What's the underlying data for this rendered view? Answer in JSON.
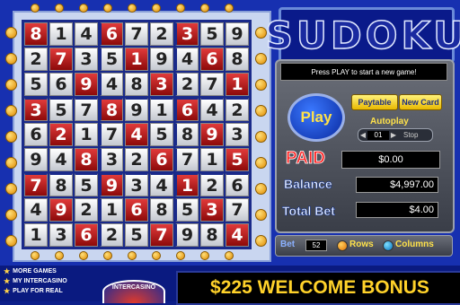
{
  "title": "SUDOKU",
  "board": {
    "rows": [
      [
        "8",
        "1",
        "4",
        "6",
        "7",
        "2",
        "3",
        "5",
        "9"
      ],
      [
        "2",
        "7",
        "3",
        "5",
        "1",
        "9",
        "4",
        "6",
        "8"
      ],
      [
        "5",
        "6",
        "9",
        "4",
        "8",
        "3",
        "2",
        "7",
        "1"
      ],
      [
        "3",
        "5",
        "7",
        "8",
        "9",
        "1",
        "6",
        "4",
        "2"
      ],
      [
        "6",
        "2",
        "1",
        "7",
        "4",
        "5",
        "8",
        "9",
        "3"
      ],
      [
        "9",
        "4",
        "8",
        "3",
        "2",
        "6",
        "7",
        "1",
        "5"
      ],
      [
        "7",
        "8",
        "5",
        "9",
        "3",
        "4",
        "1",
        "2",
        "6"
      ],
      [
        "4",
        "9",
        "2",
        "1",
        "6",
        "8",
        "5",
        "3",
        "7"
      ],
      [
        "1",
        "3",
        "6",
        "2",
        "5",
        "7",
        "9",
        "8",
        "4"
      ]
    ],
    "red_cells": [
      [
        true,
        false,
        false,
        true,
        false,
        false,
        true,
        false,
        false
      ],
      [
        false,
        true,
        false,
        false,
        true,
        false,
        false,
        true,
        false
      ],
      [
        false,
        false,
        true,
        false,
        false,
        true,
        false,
        false,
        true
      ],
      [
        true,
        false,
        false,
        true,
        false,
        false,
        true,
        false,
        false
      ],
      [
        false,
        true,
        false,
        false,
        true,
        false,
        false,
        true,
        false
      ],
      [
        false,
        false,
        true,
        false,
        false,
        true,
        false,
        false,
        true
      ],
      [
        true,
        false,
        false,
        true,
        false,
        false,
        true,
        false,
        false
      ],
      [
        false,
        true,
        false,
        false,
        true,
        false,
        false,
        true,
        false
      ],
      [
        false,
        false,
        true,
        false,
        false,
        true,
        false,
        false,
        true
      ]
    ]
  },
  "message": "Press PLAY to start a new game!",
  "controls": {
    "play": "Play",
    "paytable": "Paytable",
    "new_card": "New Card",
    "autoplay": "Autoplay",
    "autoplay_count": "01",
    "stop": "Stop",
    "bet_label": "Bet",
    "bet_value": "52",
    "rows": "Rows",
    "columns": "Columns"
  },
  "stats": {
    "paid_label": "PAID",
    "paid_value": "$0.00",
    "balance_label": "Balance",
    "balance_value": "$4,997.00",
    "total_bet_label": "Total Bet",
    "total_bet_value": "$4.00"
  },
  "footer": {
    "links": [
      "MORE GAMES",
      "MY INTERCASINO",
      "PLAY FOR REAL"
    ],
    "logo_text": "INTERCASINO",
    "banner": "$225 WELCOME BONUS"
  },
  "colors": {
    "accent_red": "#c81818",
    "button_yellow": "#f5d020",
    "background_blue": "#1730b0"
  }
}
